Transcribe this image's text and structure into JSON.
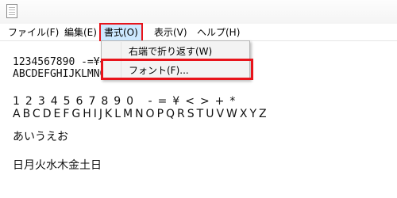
{
  "menubar": {
    "items": [
      {
        "label": "ファイル(F)"
      },
      {
        "label": "編集(E)"
      },
      {
        "label": "書式(O)"
      },
      {
        "label": "表示(V)"
      },
      {
        "label": "ヘルプ(H)"
      }
    ]
  },
  "format_menu": {
    "items": [
      {
        "label": "右端で折り返す(W)"
      },
      {
        "label": "フォント(F)..."
      }
    ]
  },
  "document": {
    "lines": [
      "1234567890 -=¥<>+*",
      "ABCDEFGHIJKLMNOPQRSTUVWXYZ",
      "1234567890 -=¥<>+*",
      "ABCDEFGHIJKLMNOPQRSTUVWXYZ",
      "あいうえお",
      "日月火水木金土日"
    ]
  },
  "colors": {
    "highlight_outline": "#e8141b",
    "active_menu_bg": "#cde8ff",
    "dropdown_bg": "#f3f3f3"
  },
  "icons": {
    "app": "notepad-icon"
  }
}
